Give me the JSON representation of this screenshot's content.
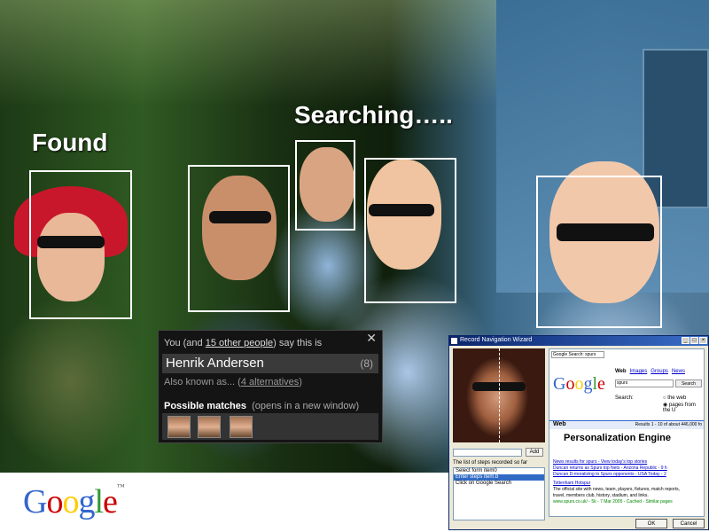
{
  "captions": {
    "found": "Found",
    "searching": "Searching….."
  },
  "popup": {
    "says_prefix": "You (and ",
    "says_link": "15 other people",
    "says_suffix": ") say this is",
    "name": "Henrik Andersen",
    "count": "(8)",
    "aka_prefix": "Also known as... (",
    "aka_link": "4 alternatives",
    "aka_suffix": ")",
    "possible_matches": "Possible matches",
    "opens_note": "(opens in a new window)",
    "close": "✕"
  },
  "google_logo": {
    "text": "Google",
    "tm": "™",
    "colors": [
      "#3366cc",
      "#cc0000",
      "#ffcc00",
      "#3366cc",
      "#339933",
      "#cc0000"
    ]
  },
  "wizard": {
    "title": "Record Navigation Wizard",
    "add_label": "Add",
    "steps_label": "The list of steps recorded so far",
    "steps": [
      "Select form item0",
      "Enter steps item.b",
      "Click on Google Search"
    ],
    "selected_step": 1,
    "url_label": "Google Search: spurs",
    "tabs": [
      "Web",
      "Images",
      "Groups",
      "News"
    ],
    "query": "spurs",
    "search_btn": "Search",
    "search_label": "Search:",
    "opt_web": "the web",
    "opt_pages": "pages from the U",
    "web_heading": "Web",
    "results_count": "Results 1 - 10 of about 446,000 fo",
    "personalization": "Personalization Engine",
    "news_results": "News results for spurs - View today's top stories",
    "news1": "Duncan returns as Spurs top Nets - Arizona Republic - 9 h",
    "news2": "Duncan D-moralizing to Spurs opponents - USA Today - 2",
    "hotspur": "Tottenham Hotspur",
    "desc1": "The official site with news, team, players, fixtures, match reports,",
    "desc2": "travel, members club, history, stadium, and links.",
    "url_line": "www.spurs.co.uk/ - 5k - 7 Mar 2005 - Cached - Similar pages",
    "ok": "OK",
    "cancel": "Cancel"
  }
}
